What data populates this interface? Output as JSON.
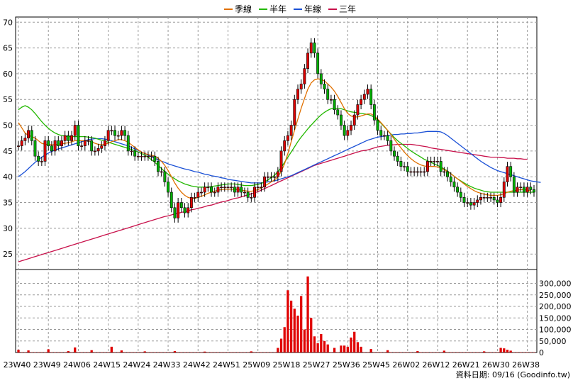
{
  "legend": [
    {
      "label": "季線",
      "color": "#e07000"
    },
    {
      "label": "半年",
      "color": "#22b800"
    },
    {
      "label": "年線",
      "color": "#1a50d6"
    },
    {
      "label": "三年",
      "color": "#c8104a"
    }
  ],
  "source": "資料日期: 09/16  (Goodinfo.tw)",
  "chart_data": {
    "type": "candlestick+line+bar",
    "price_axis": {
      "ylim": [
        22,
        71
      ],
      "ticks": [
        25,
        30,
        35,
        40,
        45,
        50,
        55,
        60,
        65,
        70
      ]
    },
    "volume_axis": {
      "ylim": [
        0,
        360000
      ],
      "ticks": [
        "0",
        "50,000",
        "100,000",
        "150,000",
        "200,000",
        "250,000",
        "300,000"
      ],
      "tick_values": [
        0,
        50000,
        100000,
        150000,
        200000,
        250000,
        300000
      ]
    },
    "x_labels": [
      "23W40",
      "23W49",
      "24W06",
      "24W15",
      "24W24",
      "24W33",
      "24W42",
      "24W51",
      "25W09",
      "25W18",
      "25W27",
      "25W36",
      "25W45",
      "26W02",
      "26W12",
      "26W21",
      "26W30",
      "26W38"
    ],
    "label_every": 9,
    "close": [
      46,
      47,
      47.5,
      49,
      47,
      44,
      43,
      43,
      47,
      46,
      45,
      47,
      46,
      47,
      48,
      47,
      48,
      50,
      46,
      46,
      47,
      47,
      45,
      45,
      45.5,
      46,
      47,
      49,
      49,
      48,
      48,
      49,
      48,
      45,
      45,
      44,
      44,
      44,
      44,
      44,
      44,
      43,
      41,
      41,
      39,
      37,
      34,
      32,
      35,
      34,
      33,
      34,
      36,
      36,
      37,
      37,
      38,
      38,
      37,
      37,
      38,
      38,
      38,
      38,
      38,
      37,
      38,
      37,
      37,
      36,
      36,
      38,
      38,
      38,
      40,
      40,
      40,
      40,
      41,
      45,
      47,
      48,
      50,
      55,
      57,
      58,
      61,
      64,
      66,
      64,
      60,
      58,
      57,
      55,
      55,
      53,
      52,
      50,
      48,
      49,
      50,
      52,
      54,
      55,
      56,
      57,
      54,
      51,
      49,
      48,
      48,
      47,
      45,
      44,
      43,
      42,
      42,
      41,
      41,
      41,
      41,
      41,
      41,
      43,
      43,
      43,
      43,
      41,
      41,
      40,
      39,
      38,
      37,
      36,
      35,
      35,
      34.5,
      35,
      35.5,
      36,
      36,
      36,
      36,
      35.5,
      35,
      36,
      39,
      42,
      40,
      37,
      38,
      38,
      37,
      38,
      37.5,
      37
    ],
    "ma_quarter": [
      50.5,
      49.5,
      48.5,
      48,
      47.8,
      47.5,
      47,
      46.5,
      46.3,
      46.3,
      46.2,
      46.2,
      46.3,
      46.4,
      46.5,
      46.6,
      46.8,
      47,
      47,
      47,
      47,
      47,
      46.8,
      46.5,
      46.3,
      46.2,
      46.3,
      46.5,
      46.8,
      47,
      47.2,
      47.2,
      47,
      46.7,
      46.2,
      45.7,
      45.2,
      44.8,
      44.5,
      44.3,
      44.2,
      44,
      43.6,
      43,
      42.2,
      41.2,
      40,
      38.8,
      37.8,
      37,
      36.4,
      36,
      35.8,
      35.8,
      36,
      36.2,
      36.5,
      36.8,
      37,
      37.2,
      37.4,
      37.5,
      37.6,
      37.6,
      37.6,
      37.5,
      37.5,
      37.4,
      37.3,
      37.2,
      37.2,
      37.3,
      37.5,
      37.8,
      38.2,
      38.6,
      39,
      39.4,
      40,
      41,
      42.5,
      44.5,
      46.8,
      49,
      51.2,
      53.3,
      55.2,
      57,
      58.2,
      58.8,
      59,
      58.9,
      58.6,
      58,
      57.4,
      56.6,
      55.6,
      54.4,
      53.2,
      52.3,
      51.8,
      51.6,
      51.6,
      51.8,
      52,
      52.2,
      52.2,
      51.8,
      51.2,
      50.5,
      49.8,
      49,
      48.2,
      47.3,
      46.4,
      45.6,
      44.8,
      44.1,
      43.5,
      43,
      42.6,
      42.3,
      42.1,
      42,
      42,
      42,
      41.9,
      41.7,
      41.4,
      41,
      40.6,
      40.1,
      39.6,
      39.1,
      38.6,
      38.1,
      37.7,
      37.3,
      37,
      36.8,
      36.6,
      36.5,
      36.4,
      36.4,
      36.4,
      36.5,
      36.7,
      37,
      37.2,
      37.3,
      37.4,
      37.5,
      37.5,
      37.4,
      37.3
    ],
    "ma_half": [
      53,
      53.5,
      53.8,
      53.5,
      53,
      52.3,
      51.5,
      50.7,
      50,
      49.4,
      48.9,
      48.5,
      48.2,
      48,
      47.9,
      47.8,
      47.8,
      47.8,
      47.8,
      47.8,
      47.8,
      47.7,
      47.6,
      47.5,
      47.3,
      47.1,
      46.9,
      46.7,
      46.5,
      46.3,
      46.1,
      45.9,
      45.7,
      45.5,
      45.3,
      45.1,
      44.8,
      44.5,
      44.2,
      43.8,
      43.3,
      42.8,
      42.2,
      41.6,
      41,
      40.5,
      40,
      39.6,
      39.2,
      38.9,
      38.6,
      38.4,
      38.2,
      38.1,
      38,
      38,
      38,
      38,
      38.1,
      38.2,
      38.3,
      38.4,
      38.5,
      38.6,
      38.6,
      38.6,
      38.5,
      38.4,
      38.3,
      38.3,
      38.3,
      38.4,
      38.5,
      38.7,
      39,
      39.4,
      39.8,
      40.3,
      41,
      41.8,
      42.8,
      43.8,
      44.8,
      45.8,
      46.8,
      47.7,
      48.5,
      49.3,
      50,
      50.7,
      51.4,
      52,
      52.5,
      52.9,
      53.2,
      53.3,
      53.3,
      53.2,
      53,
      52.8,
      52.6,
      52.5,
      52.4,
      52.3,
      52.2,
      52.1,
      51.9,
      51.5,
      51,
      50.4,
      49.7,
      49,
      48.3,
      47.6,
      47,
      46.5,
      46,
      45.5,
      45,
      44.6,
      44.2,
      43.8,
      43.4,
      43.1,
      42.8,
      42.5,
      42.2,
      41.9,
      41.5,
      41.1,
      40.6,
      40.1,
      39.6,
      39.2,
      38.8,
      38.4,
      38.1,
      37.8,
      37.6,
      37.4,
      37.2,
      37.1,
      37,
      37,
      37,
      37,
      37,
      37,
      37,
      37,
      37,
      37,
      37,
      37,
      37,
      37
    ],
    "ma_year": [
      40,
      40.5,
      41,
      41.6,
      42.2,
      42.8,
      43.3,
      43.8,
      44.2,
      44.6,
      44.9,
      45.2,
      45.4,
      45.6,
      45.8,
      46,
      46.2,
      46.4,
      46.6,
      46.8,
      47,
      47.2,
      47.3,
      47.4,
      47.4,
      47.4,
      47.3,
      47.2,
      47,
      46.8,
      46.6,
      46.4,
      46.2,
      46,
      45.7,
      45.4,
      45.1,
      44.8,
      44.5,
      44.2,
      43.9,
      43.6,
      43.3,
      43,
      42.8,
      42.5,
      42.3,
      42.1,
      41.9,
      41.7,
      41.5,
      41.4,
      41.2,
      41,
      40.9,
      40.7,
      40.5,
      40.4,
      40.2,
      40.1,
      40,
      39.8,
      39.7,
      39.5,
      39.4,
      39.3,
      39.2,
      39.1,
      39,
      38.9,
      38.8,
      38.8,
      38.8,
      38.8,
      38.9,
      39,
      39.1,
      39.2,
      39.4,
      39.6,
      39.8,
      40,
      40.2,
      40.5,
      40.8,
      41.1,
      41.4,
      41.7,
      42,
      42.3,
      42.6,
      42.9,
      43.2,
      43.5,
      43.8,
      44.1,
      44.4,
      44.7,
      45,
      45.3,
      45.6,
      45.9,
      46.2,
      46.5,
      46.8,
      47.1,
      47.3,
      47.5,
      47.7,
      47.8,
      47.9,
      48,
      48.1,
      48.2,
      48.2,
      48.3,
      48.3,
      48.4,
      48.4,
      48.5,
      48.5,
      48.6,
      48.7,
      48.8,
      48.8,
      48.8,
      48.8,
      48.7,
      48.4,
      48,
      47.5,
      47,
      46.5,
      46,
      45.5,
      45,
      44.5,
      44,
      43.5,
      43,
      42.6,
      42.2,
      41.8,
      41.5,
      41.2,
      41,
      40.8,
      40.6,
      40.4,
      40.2,
      40,
      39.8,
      39.6,
      39.4,
      39.2,
      39.1,
      39,
      38.9
    ],
    "ma_3year": [
      23.5,
      23.7,
      23.9,
      24.1,
      24.3,
      24.5,
      24.7,
      24.9,
      25.1,
      25.3,
      25.5,
      25.7,
      25.9,
      26.1,
      26.3,
      26.5,
      26.7,
      26.9,
      27.1,
      27.3,
      27.5,
      27.7,
      27.9,
      28.1,
      28.3,
      28.5,
      28.7,
      28.9,
      29.1,
      29.3,
      29.5,
      29.7,
      29.9,
      30.1,
      30.3,
      30.5,
      30.7,
      30.9,
      31.1,
      31.3,
      31.5,
      31.7,
      31.9,
      32.1,
      32.3,
      32.4,
      32.6,
      32.8,
      32.9,
      33.1,
      33.2,
      33.4,
      33.6,
      33.7,
      33.9,
      34,
      34.2,
      34.4,
      34.5,
      34.7,
      34.9,
      35.1,
      35.2,
      35.4,
      35.6,
      35.8,
      35.9,
      36.1,
      36.3,
      36.5,
      36.7,
      36.9,
      37.1,
      37.4,
      37.7,
      38,
      38.3,
      38.6,
      38.9,
      39.2,
      39.5,
      39.8,
      40.1,
      40.4,
      40.7,
      41,
      41.3,
      41.6,
      41.9,
      42.2,
      42.4,
      42.6,
      42.8,
      43,
      43.2,
      43.4,
      43.6,
      43.8,
      44,
      44.2,
      44.4,
      44.6,
      44.8,
      45,
      45.1,
      45.2,
      45.4,
      45.6,
      45.8,
      45.9,
      46,
      46.1,
      46.2,
      46.2,
      46.3,
      46.3,
      46.3,
      46.3,
      46.3,
      46.2,
      46.1,
      46,
      45.9,
      45.8,
      45.6,
      45.5,
      45.4,
      45.3,
      45.2,
      45.1,
      45,
      44.9,
      44.8,
      44.7,
      44.6,
      44.5,
      44.4,
      44.3,
      44.2,
      44.1,
      44,
      43.9,
      43.8,
      43.8,
      43.8,
      43.7,
      43.7,
      43.6,
      43.6,
      43.6,
      43.5,
      43.5,
      43.4,
      43.4
    ],
    "volume_peaks": [
      [
        0,
        12000
      ],
      [
        3,
        9000
      ],
      [
        9,
        14000
      ],
      [
        15,
        6000
      ],
      [
        17,
        22000
      ],
      [
        22,
        10000
      ],
      [
        28,
        25000
      ],
      [
        31,
        9000
      ],
      [
        38,
        5000
      ],
      [
        47,
        6000
      ],
      [
        56,
        4000
      ],
      [
        70,
        5000
      ],
      [
        78,
        20000
      ],
      [
        79,
        60000
      ],
      [
        80,
        110000
      ],
      [
        81,
        270000
      ],
      [
        82,
        225000
      ],
      [
        83,
        190000
      ],
      [
        84,
        160000
      ],
      [
        85,
        245000
      ],
      [
        86,
        100000
      ],
      [
        87,
        330000
      ],
      [
        88,
        150000
      ],
      [
        89,
        70000
      ],
      [
        90,
        40000
      ],
      [
        91,
        80000
      ],
      [
        92,
        50000
      ],
      [
        93,
        35000
      ],
      [
        95,
        20000
      ],
      [
        97,
        30000
      ],
      [
        98,
        30000
      ],
      [
        99,
        25000
      ],
      [
        100,
        65000
      ],
      [
        101,
        90000
      ],
      [
        102,
        45000
      ],
      [
        103,
        25000
      ],
      [
        106,
        15000
      ],
      [
        111,
        10000
      ],
      [
        120,
        6000
      ],
      [
        128,
        8000
      ],
      [
        140,
        5000
      ],
      [
        145,
        20000
      ],
      [
        146,
        18000
      ],
      [
        147,
        12000
      ],
      [
        148,
        8000
      ]
    ],
    "grid": true,
    "legend_position": "top-center"
  }
}
